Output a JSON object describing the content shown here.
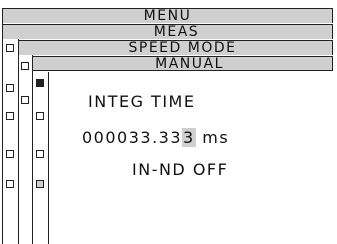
{
  "menu": {
    "level1": "MENU",
    "level2": "MEAS",
    "level3": "SPEED MODE",
    "level4": "MANUAL"
  },
  "integ_time": {
    "label": "INTEG TIME",
    "value_prefix": "000033.33",
    "value_cursor_digit": "3",
    "unit": " ms"
  },
  "nd": {
    "status": "IN-ND OFF"
  },
  "colors": {
    "bar_background": "#cfcfcf",
    "line": "#222222",
    "cursor_highlight": "#cfcfcf"
  }
}
